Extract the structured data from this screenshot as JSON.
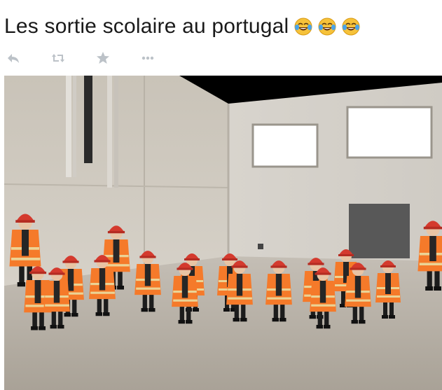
{
  "tweet": {
    "text": "Les sortie scolaire au portugal",
    "emojis": [
      "tears-of-joy-emoji",
      "tears-of-joy-emoji",
      "tears-of-joy-emoji"
    ]
  },
  "actions": [
    {
      "name": "reply",
      "icon": "reply-icon"
    },
    {
      "name": "retweet",
      "icon": "retweet-icon"
    },
    {
      "name": "favorite",
      "icon": "star-icon"
    },
    {
      "name": "more",
      "icon": "more-icon"
    }
  ],
  "photo": {
    "subject": "group-of-children-in-orange-safety-vests-and-red-hard-hats-in-concrete-building"
  },
  "colors": {
    "icon_gray": "#bcc2c8",
    "vest_orange": "#f57a2a",
    "helmet_red": "#d43a2e",
    "wall": "#cfcac1",
    "floor": "#b9b3aa"
  }
}
